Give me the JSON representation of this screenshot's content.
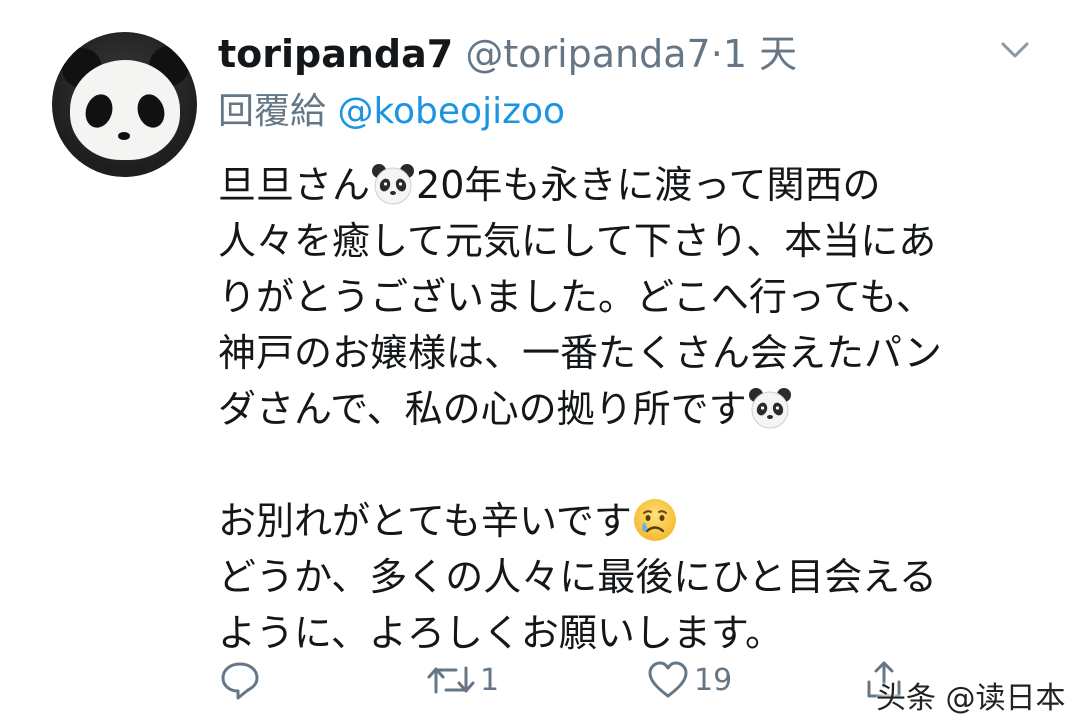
{
  "tweet": {
    "display_name": "toripanda7",
    "handle": "@toripanda7",
    "separator": "·",
    "time": "1 天",
    "reply_label": "回覆給",
    "reply_handle": "@kobeojizoo",
    "lines": [
      "旦旦さん",
      "20年も永きに渡って関西の",
      "人々を癒して元気にして下さり、本当にあ",
      "りがとうございました。どこへ行っても、",
      "神戸のお嬢様は、一番たくさん会えたパン",
      "ダさんで、私の心の拠り所です",
      "お別れがとても辛いです",
      "どうか、多くの人々に最後にひと目会える",
      "ように、よろしくお願いします。"
    ],
    "emojis": {
      "panda_1": "panda-emoji",
      "panda_2": "panda-emoji",
      "crying": "crying-face-emoji"
    }
  },
  "actions": {
    "reply_icon": "reply-icon",
    "retweet_icon": "retweet-icon",
    "retweet_count": "1",
    "like_icon": "heart-icon",
    "like_count": "19",
    "share_icon": "share-icon"
  },
  "watermark": "头条 @读日本",
  "colors": {
    "name": "#14171a",
    "secondary": "#657786",
    "link": "#1b95e0",
    "background": "#ffffff"
  }
}
